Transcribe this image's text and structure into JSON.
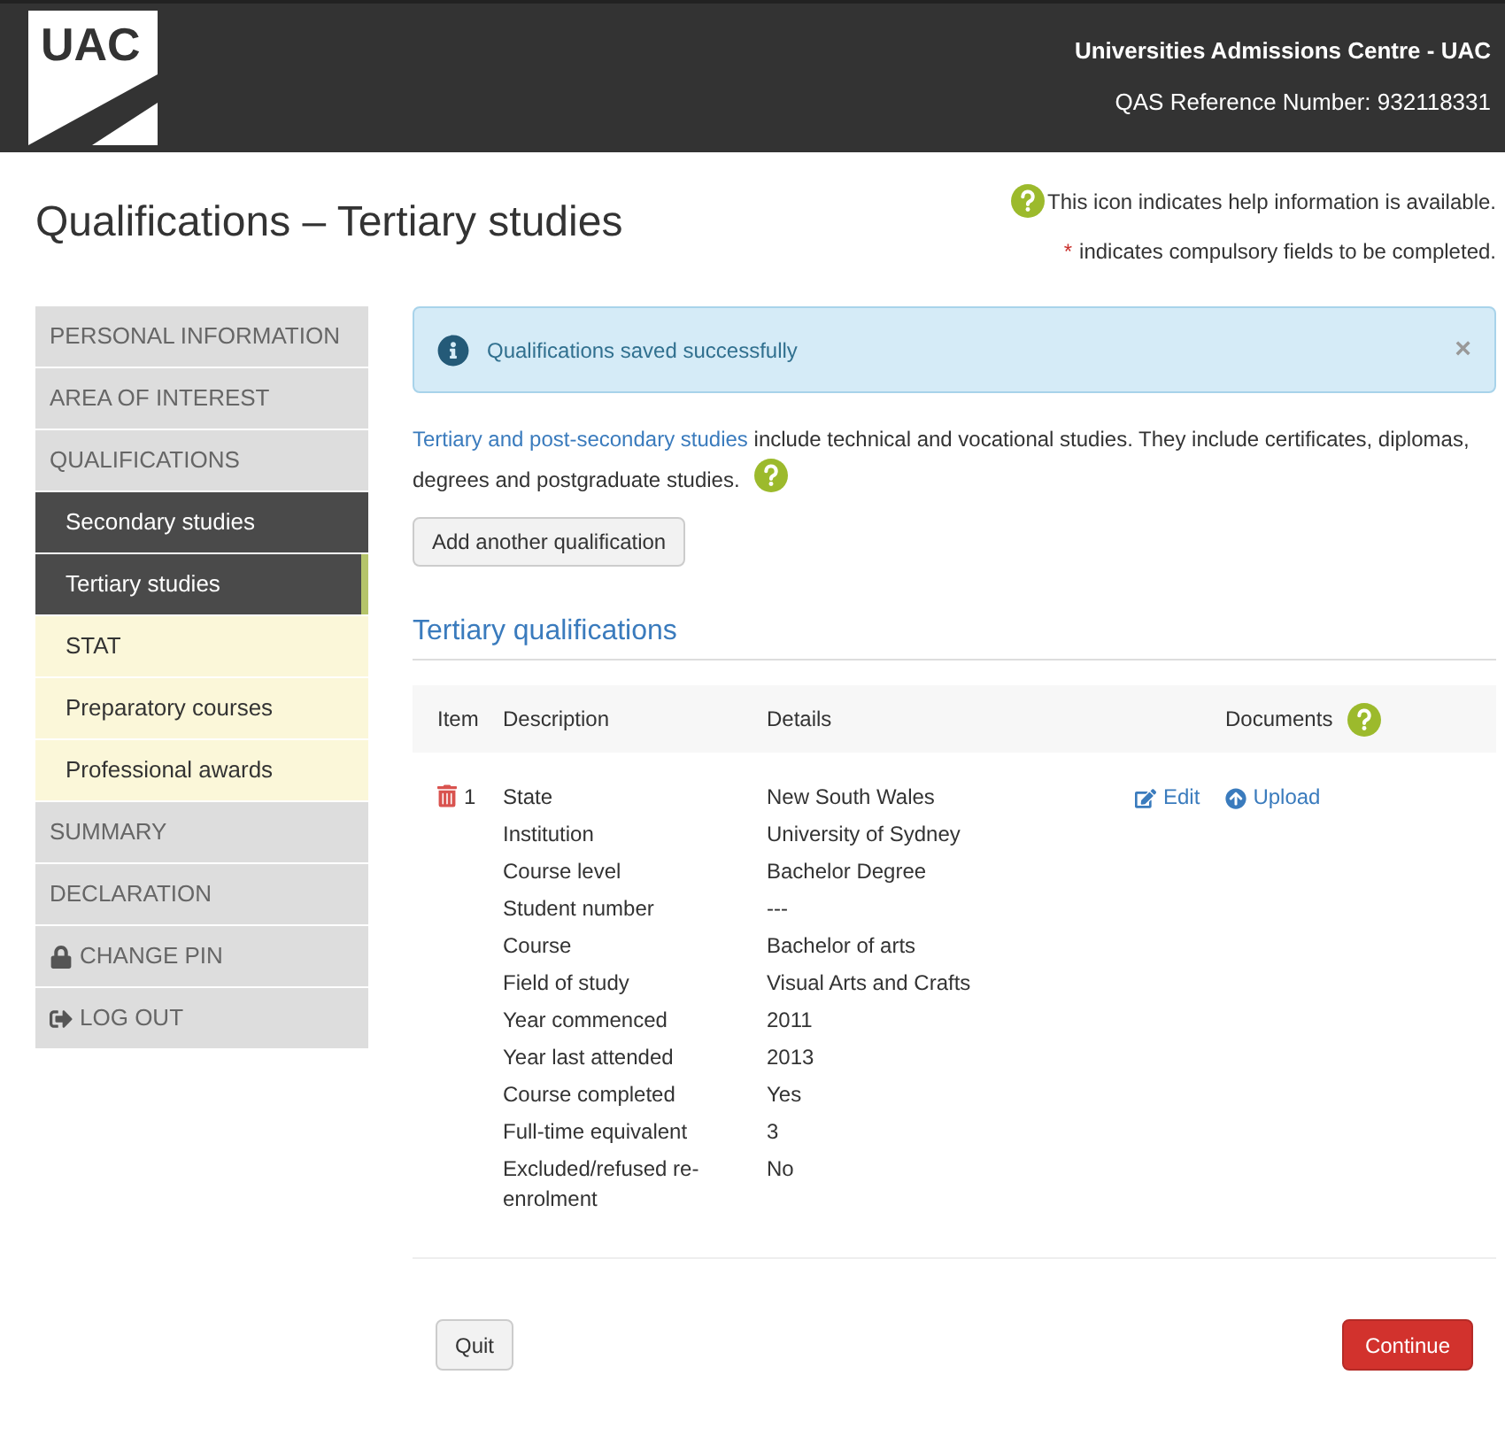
{
  "header": {
    "logo": "UAC",
    "organization": "Universities Admissions Centre - UAC",
    "reference": "QAS Reference Number: 932118331"
  },
  "page_title": "Qualifications – Tertiary studies",
  "legend": {
    "help": "This icon indicates help information is available.",
    "required_mark": "*",
    "required": "indicates compulsory fields to be completed."
  },
  "sidebar": {
    "items": [
      {
        "label": "PERSONAL INFORMATION",
        "kind": "section",
        "selected": false
      },
      {
        "label": "AREA OF INTEREST",
        "kind": "section",
        "selected": false
      },
      {
        "label": "QUALIFICATIONS",
        "kind": "section",
        "selected": false
      },
      {
        "label": "Secondary studies",
        "kind": "sub",
        "done": true,
        "selected": false
      },
      {
        "label": "Tertiary studies",
        "kind": "sub",
        "done": true,
        "selected": true
      },
      {
        "label": "STAT",
        "kind": "sub",
        "done": false,
        "selected": false
      },
      {
        "label": "Preparatory courses",
        "kind": "sub",
        "done": false,
        "selected": false
      },
      {
        "label": "Professional awards",
        "kind": "sub",
        "done": false,
        "selected": false
      },
      {
        "label": "SUMMARY",
        "kind": "section",
        "selected": false
      },
      {
        "label": "DECLARATION",
        "kind": "section",
        "selected": false
      },
      {
        "label": "CHANGE PIN",
        "kind": "lock",
        "selected": false
      },
      {
        "label": "LOG OUT",
        "kind": "logout",
        "selected": false
      }
    ]
  },
  "alert": {
    "message": "Qualifications saved successfully",
    "close": "×"
  },
  "intro": {
    "link": "Tertiary and post-secondary studies",
    "text": " include technical and vocational studies. They include certificates, diplomas, degrees and postgraduate studies."
  },
  "add_button": "Add another qualification",
  "section_title": "Tertiary qualifications",
  "table": {
    "columns": [
      "Item",
      "Description",
      "Details",
      "Documents"
    ],
    "rows": [
      {
        "item": "1",
        "edit": "Edit",
        "upload": "Upload",
        "fields": [
          {
            "label": "State",
            "value": "New South Wales"
          },
          {
            "label": "Institution",
            "value": "University of Sydney"
          },
          {
            "label": "Course level",
            "value": "Bachelor Degree"
          },
          {
            "label": "Student number",
            "value": "---"
          },
          {
            "label": "Course",
            "value": "Bachelor of arts"
          },
          {
            "label": "Field of study",
            "value": "Visual Arts and Crafts"
          },
          {
            "label": "Year commenced",
            "value": "2011"
          },
          {
            "label": "Year last attended",
            "value": "2013"
          },
          {
            "label": "Course completed",
            "value": "Yes"
          },
          {
            "label": "Full-time equivalent",
            "value": "3"
          },
          {
            "label": "Excluded/refused re-enrolment",
            "value": "No"
          }
        ]
      }
    ]
  },
  "buttons": {
    "quit": "Quit",
    "continue": "Continue"
  }
}
